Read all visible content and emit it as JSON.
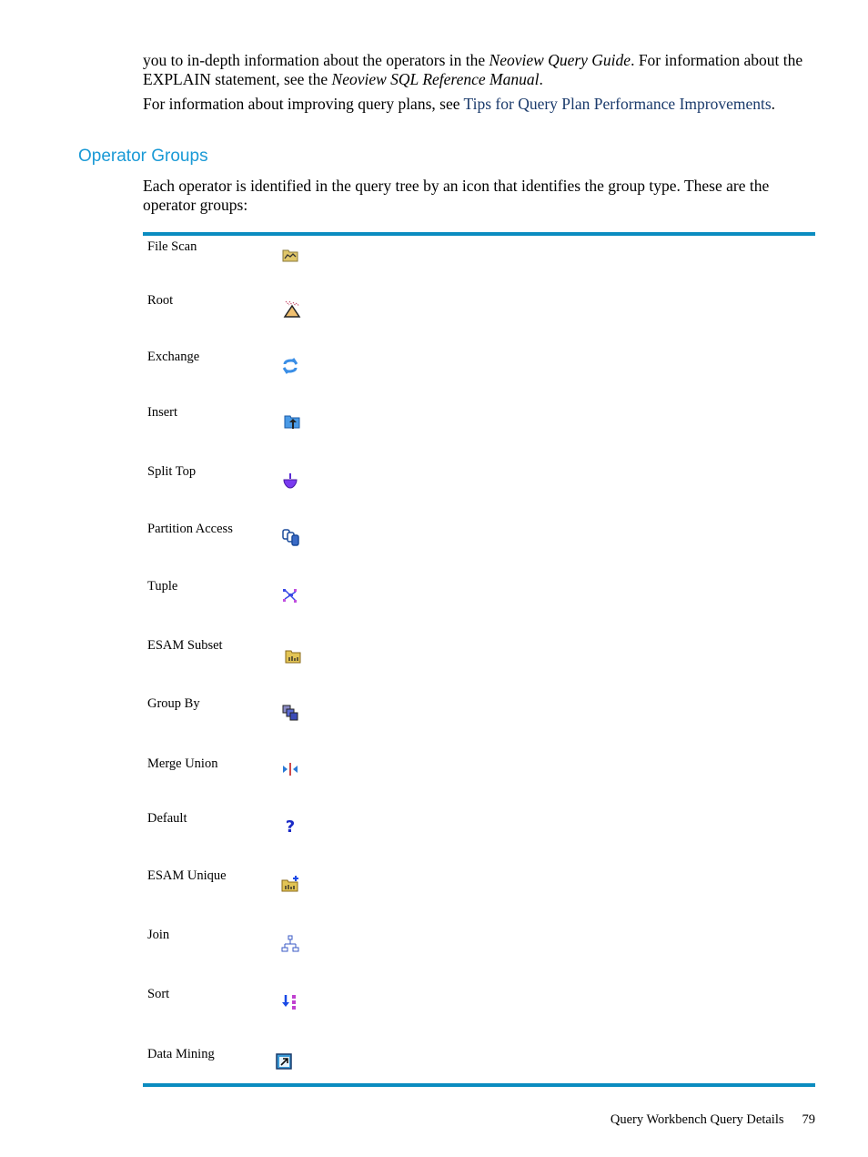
{
  "intro": {
    "p1_part1": "you to in-depth information about the operators in the ",
    "p1_italic1": "Neoview Query Guide",
    "p1_part2": ". For information about the EXPLAIN statement, see the ",
    "p1_italic2": "Neoview SQL Reference Manual",
    "p1_part3": ".",
    "p2_part1": "For information about improving query plans, see ",
    "p2_link": "Tips for Query Plan Performance Improvements",
    "p2_part2": "."
  },
  "section": {
    "heading": "Operator Groups",
    "description": "Each operator is identified in the query tree by an icon that identifies the group type. These are the operator groups:"
  },
  "operator_groups": [
    {
      "label": "File Scan",
      "icon": "folder-chart-icon"
    },
    {
      "label": "Root",
      "icon": "root-cone-icon"
    },
    {
      "label": "Exchange",
      "icon": "exchange-arrows-icon"
    },
    {
      "label": "Insert",
      "icon": "folder-insert-icon"
    },
    {
      "label": "Split Top",
      "icon": "spinning-top-icon"
    },
    {
      "label": "Partition Access",
      "icon": "partition-cylinders-icon"
    },
    {
      "label": "Tuple",
      "icon": "tuple-network-icon"
    },
    {
      "label": "ESAM Subset",
      "icon": "folder-bars-icon"
    },
    {
      "label": "Group By",
      "icon": "group-by-stack-icon"
    },
    {
      "label": "Merge Union",
      "icon": "merge-arrows-icon"
    },
    {
      "label": "Default",
      "icon": "question-mark-icon"
    },
    {
      "label": "ESAM Unique",
      "icon": "folder-bars-plus-icon"
    },
    {
      "label": "Join",
      "icon": "join-tree-icon"
    },
    {
      "label": "Sort",
      "icon": "sort-arrow-icon"
    },
    {
      "label": "Data Mining",
      "icon": "data-mining-shortcut-icon"
    }
  ],
  "footer": {
    "section_title": "Query Workbench Query Details",
    "page_number": "79"
  }
}
